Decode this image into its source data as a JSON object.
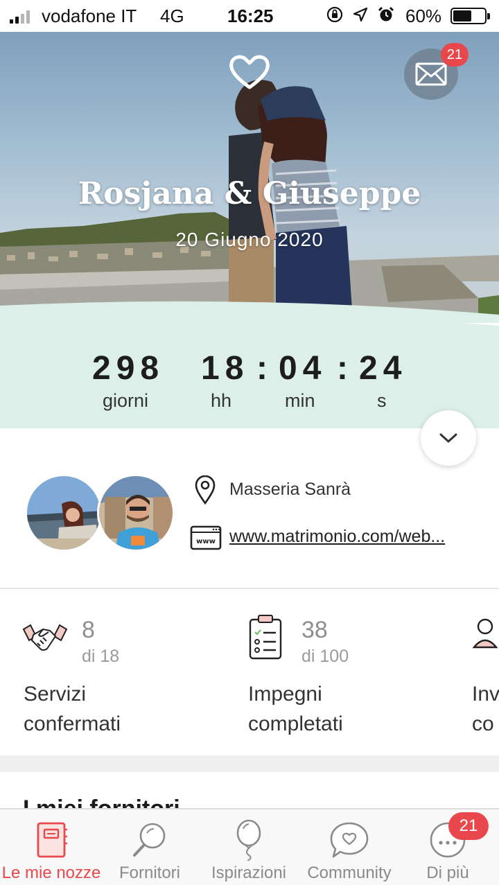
{
  "status_bar": {
    "carrier": "vodafone IT",
    "network": "4G",
    "time": "16:25",
    "battery": "60%",
    "battery_level": 0.6
  },
  "header": {
    "couple_name": "Rosjana & Giuseppe",
    "wedding_date": "20 Giugno 2020",
    "messages_badge": "21"
  },
  "countdown": {
    "days": "298",
    "hours": "18",
    "minutes": "04",
    "seconds": "24",
    "sep": ":",
    "days_label": "giorni",
    "hours_label": "hh",
    "minutes_label": "min",
    "seconds_label": "s"
  },
  "info": {
    "venue": "Masseria Sanrà",
    "website": "www.matrimonio.com/web..."
  },
  "stats": [
    {
      "icon": "handshake-icon",
      "value": "8",
      "total": "di 18",
      "label_line1": "Servizi",
      "label_line2": "confermati"
    },
    {
      "icon": "checklist-icon",
      "value": "38",
      "total": "di 100",
      "label_line1": "Impegni",
      "label_line2": "completati"
    },
    {
      "icon": "guests-icon",
      "label_line1": "Inv",
      "label_line2": "co"
    }
  ],
  "next_section": {
    "heading": "I miei fornitori"
  },
  "tab_bar": {
    "tabs": [
      {
        "label": "Le mie nozze",
        "icon": "planner-book-icon",
        "active": true
      },
      {
        "label": "Fornitori",
        "icon": "magnifier-icon",
        "active": false
      },
      {
        "label": "Ispirazioni",
        "icon": "balloon-icon",
        "active": false
      },
      {
        "label": "Community",
        "icon": "chat-heart-icon",
        "active": false
      },
      {
        "label": "Di più",
        "icon": "more-dots-icon",
        "active": false
      }
    ],
    "more_badge": "21"
  },
  "colors": {
    "accent": "#e8474b",
    "mint": "#dcefe8",
    "text_dark": "#1d1d1d",
    "muted": "#8e8e8e"
  }
}
